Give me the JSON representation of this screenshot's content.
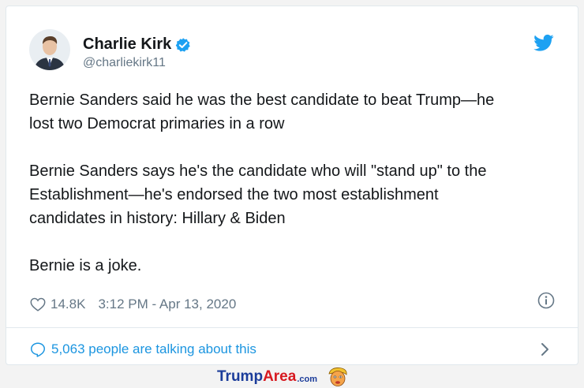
{
  "tweet": {
    "author_name": "Charlie Kirk",
    "handle": "@charliekirk11",
    "paragraphs": [
      "Bernie Sanders said he was the best candidate to beat Trump—he\nlost two Democrat primaries in a row",
      "Bernie Sanders says he's the candidate who will \"stand up\" to the\nEstablishment—he's endorsed the two most establishment\ncandidates in history: Hillary & Biden",
      "Bernie is a joke."
    ],
    "likes": "14.8K",
    "timestamp": "3:12 PM - Apr 13, 2020",
    "talking": "5,063 people are talking about this"
  },
  "footer": {
    "brand_part1": "Trump",
    "brand_part2": "Area",
    "brand_tld": ".com"
  },
  "colors": {
    "accent": "#1da1f2",
    "link": "#1b95e0",
    "muted": "#657786",
    "brand_blue": "#1b3c9a",
    "brand_red": "#d71920"
  },
  "icons": [
    "verified-badge-icon",
    "twitter-bird-icon",
    "heart-icon",
    "info-icon",
    "comment-bubble-icon",
    "chevron-right-icon",
    "trump-caricature-icon"
  ]
}
